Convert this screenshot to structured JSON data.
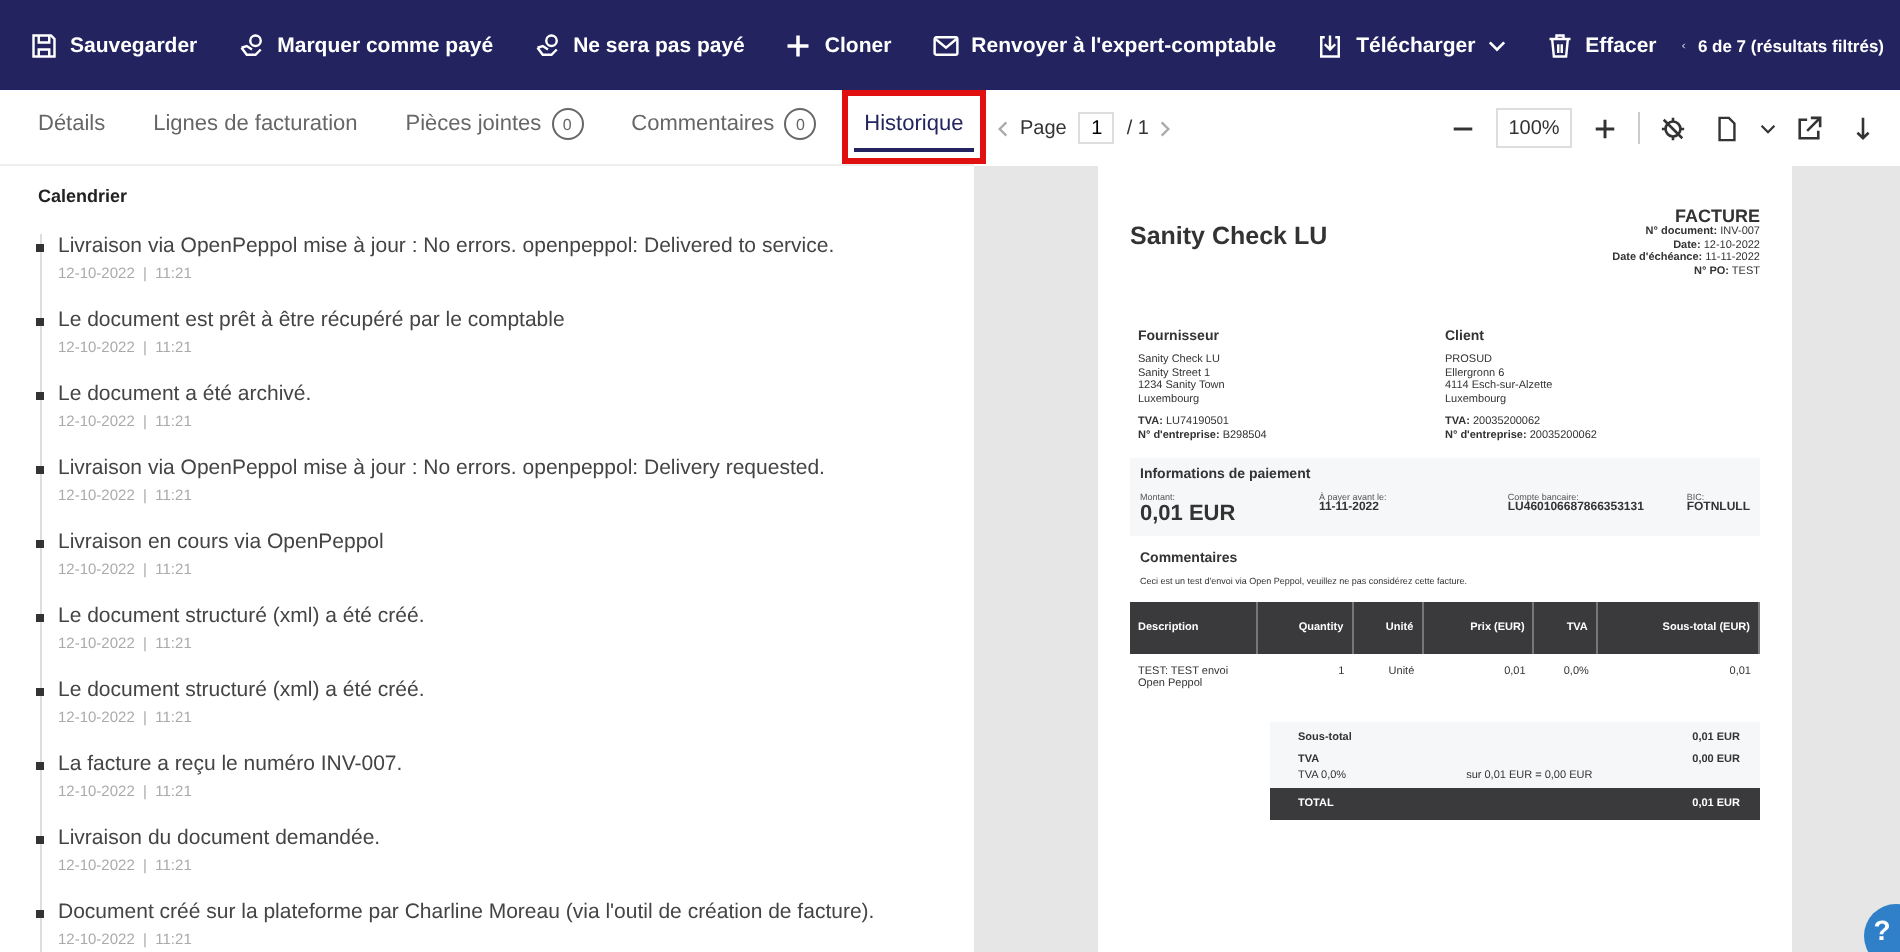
{
  "toolbar": {
    "actions": [
      {
        "kind": "save",
        "label": "Sauvegarder"
      },
      {
        "kind": "paid",
        "label": "Marquer comme payé"
      },
      {
        "kind": "unpaid",
        "label": "Ne sera pas payé"
      },
      {
        "kind": "clone",
        "label": "Cloner"
      },
      {
        "kind": "mail",
        "label": "Renvoyer à l'expert-comptable"
      },
      {
        "kind": "download",
        "label": "Télécharger",
        "dropdown": true
      },
      {
        "kind": "delete",
        "label": "Effacer"
      }
    ],
    "pager": "6 de 7 (résultats filtrés)"
  },
  "tabs": [
    {
      "label": "Détails",
      "selected": false,
      "annotated": false
    },
    {
      "label": "Lignes de facturation",
      "selected": false,
      "annotated": false
    },
    {
      "label": "Pièces jointes",
      "selected": false,
      "count": "0",
      "annotated": false
    },
    {
      "label": "Commentaires",
      "selected": false,
      "count": "0",
      "annotated": false
    },
    {
      "label": "Historique",
      "selected": true,
      "annotated": true
    }
  ],
  "viewer": {
    "page_label": "Page",
    "page": "1",
    "total": "/ 1",
    "zoom": "100%"
  },
  "timeline": {
    "title": "Calendrier",
    "events": [
      {
        "text": "Livraison via OpenPeppol mise à jour : No errors. openpeppol: Delivered to service.",
        "meta": "12-10-2022  |  11:21"
      },
      {
        "text": "Le document est prêt à être récupéré par le comptable",
        "meta": "12-10-2022  |  11:21"
      },
      {
        "text": "Le document a été archivé.",
        "meta": "12-10-2022  |  11:21"
      },
      {
        "text": "Livraison via OpenPeppol mise à jour : No errors. openpeppol: Delivery requested.",
        "meta": "12-10-2022  |  11:21"
      },
      {
        "text": "Livraison en cours via OpenPeppol",
        "meta": "12-10-2022  |  11:21"
      },
      {
        "text": "Le document structuré (xml) a été créé.",
        "meta": "12-10-2022  |  11:21"
      },
      {
        "text": "Le document structuré (xml) a été créé.",
        "meta": "12-10-2022  |  11:21"
      },
      {
        "text": "La facture a reçu le numéro INV-007.",
        "meta": "12-10-2022  |  11:21"
      },
      {
        "text": "Livraison du document demandée.",
        "meta": "12-10-2022  |  11:21"
      },
      {
        "text": "Document créé sur la plateforme par Charline Moreau (via l'outil de création de facture).",
        "meta": "12-10-2022  |  11:21"
      }
    ]
  },
  "invoice": {
    "company": "Sanity Check LU",
    "title": "FACTURE",
    "meta": [
      {
        "label": "N° document:",
        "value": "INV-007"
      },
      {
        "label": "Date:",
        "value": "12-10-2022"
      },
      {
        "label": "Date d'échéance:",
        "value": "11-11-2022"
      },
      {
        "label": "N° PO:",
        "value": "TEST"
      }
    ],
    "parties": [
      {
        "heading": "Fournisseur",
        "lines": [
          "Sanity Check LU",
          "Sanity Street 1",
          "1234 Sanity Town",
          "Luxembourg"
        ],
        "ids": [
          {
            "label": "TVA:",
            "value": "LU74190501"
          },
          {
            "label": "N° d'entreprise:",
            "value": "B298504"
          }
        ]
      },
      {
        "heading": "Client",
        "lines": [
          "PROSUD",
          "Ellergronn 6",
          "4114 Esch-sur-Alzette",
          "Luxembourg"
        ],
        "ids": [
          {
            "label": "TVA:",
            "value": "20035200062"
          },
          {
            "label": "N° d'entreprise:",
            "value": "20035200062"
          }
        ]
      }
    ],
    "payment": {
      "heading": "Informations de paiement",
      "fields": [
        {
          "label": "Montant:",
          "value": "0,01 EUR"
        },
        {
          "label": "À payer avant le:",
          "value": "11-11-2022"
        },
        {
          "label": "Compte bancaire:",
          "value": "LU460106687866353131"
        },
        {
          "label": "BIC:",
          "value": "FOTNLULL"
        }
      ]
    },
    "comments": {
      "heading": "Commentaires",
      "text": "Ceci est un test d'envoi via Open Peppol, veuillez ne pas considérez cette facture."
    },
    "columns": [
      "Description",
      "Quantity",
      "Unité",
      "Prix (EUR)",
      "TVA",
      "Sous-total (EUR)"
    ],
    "rows": [
      [
        "TEST: TEST envoi Open Peppol",
        "1",
        "Unité",
        "0,01",
        "0,0%",
        "0,01"
      ]
    ],
    "totals": {
      "subtotal_label": "Sous-total",
      "subtotal": "0,01 EUR",
      "vat_label": "TVA",
      "vat": "0,00 EUR",
      "vat_rate": "TVA 0,0%",
      "vat_detail": "sur 0,01 EUR = 0,00 EUR",
      "total_label": "TOTAL",
      "total": "0,01 EUR"
    }
  },
  "help": "?"
}
